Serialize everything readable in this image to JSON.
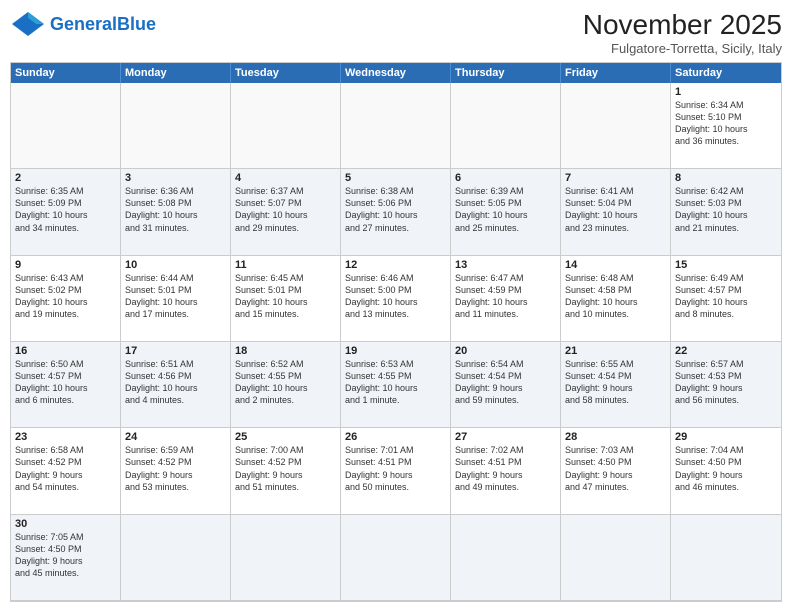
{
  "header": {
    "logo_general": "General",
    "logo_blue": "Blue",
    "month_title": "November 2025",
    "location": "Fulgatore-Torretta, Sicily, Italy"
  },
  "day_headers": [
    "Sunday",
    "Monday",
    "Tuesday",
    "Wednesday",
    "Thursday",
    "Friday",
    "Saturday"
  ],
  "cells": [
    {
      "day": "",
      "info": "",
      "empty": true
    },
    {
      "day": "",
      "info": "",
      "empty": true
    },
    {
      "day": "",
      "info": "",
      "empty": true
    },
    {
      "day": "",
      "info": "",
      "empty": true
    },
    {
      "day": "",
      "info": "",
      "empty": true
    },
    {
      "day": "",
      "info": "",
      "empty": true
    },
    {
      "day": "1",
      "info": "Sunrise: 6:34 AM\nSunset: 5:10 PM\nDaylight: 10 hours\nand 36 minutes.",
      "empty": false
    },
    {
      "day": "2",
      "info": "Sunrise: 6:35 AM\nSunset: 5:09 PM\nDaylight: 10 hours\nand 34 minutes.",
      "empty": false
    },
    {
      "day": "3",
      "info": "Sunrise: 6:36 AM\nSunset: 5:08 PM\nDaylight: 10 hours\nand 31 minutes.",
      "empty": false
    },
    {
      "day": "4",
      "info": "Sunrise: 6:37 AM\nSunset: 5:07 PM\nDaylight: 10 hours\nand 29 minutes.",
      "empty": false
    },
    {
      "day": "5",
      "info": "Sunrise: 6:38 AM\nSunset: 5:06 PM\nDaylight: 10 hours\nand 27 minutes.",
      "empty": false
    },
    {
      "day": "6",
      "info": "Sunrise: 6:39 AM\nSunset: 5:05 PM\nDaylight: 10 hours\nand 25 minutes.",
      "empty": false
    },
    {
      "day": "7",
      "info": "Sunrise: 6:41 AM\nSunset: 5:04 PM\nDaylight: 10 hours\nand 23 minutes.",
      "empty": false
    },
    {
      "day": "8",
      "info": "Sunrise: 6:42 AM\nSunset: 5:03 PM\nDaylight: 10 hours\nand 21 minutes.",
      "empty": false
    },
    {
      "day": "9",
      "info": "Sunrise: 6:43 AM\nSunset: 5:02 PM\nDaylight: 10 hours\nand 19 minutes.",
      "empty": false
    },
    {
      "day": "10",
      "info": "Sunrise: 6:44 AM\nSunset: 5:01 PM\nDaylight: 10 hours\nand 17 minutes.",
      "empty": false
    },
    {
      "day": "11",
      "info": "Sunrise: 6:45 AM\nSunset: 5:01 PM\nDaylight: 10 hours\nand 15 minutes.",
      "empty": false
    },
    {
      "day": "12",
      "info": "Sunrise: 6:46 AM\nSunset: 5:00 PM\nDaylight: 10 hours\nand 13 minutes.",
      "empty": false
    },
    {
      "day": "13",
      "info": "Sunrise: 6:47 AM\nSunset: 4:59 PM\nDaylight: 10 hours\nand 11 minutes.",
      "empty": false
    },
    {
      "day": "14",
      "info": "Sunrise: 6:48 AM\nSunset: 4:58 PM\nDaylight: 10 hours\nand 10 minutes.",
      "empty": false
    },
    {
      "day": "15",
      "info": "Sunrise: 6:49 AM\nSunset: 4:57 PM\nDaylight: 10 hours\nand 8 minutes.",
      "empty": false
    },
    {
      "day": "16",
      "info": "Sunrise: 6:50 AM\nSunset: 4:57 PM\nDaylight: 10 hours\nand 6 minutes.",
      "empty": false
    },
    {
      "day": "17",
      "info": "Sunrise: 6:51 AM\nSunset: 4:56 PM\nDaylight: 10 hours\nand 4 minutes.",
      "empty": false
    },
    {
      "day": "18",
      "info": "Sunrise: 6:52 AM\nSunset: 4:55 PM\nDaylight: 10 hours\nand 2 minutes.",
      "empty": false
    },
    {
      "day": "19",
      "info": "Sunrise: 6:53 AM\nSunset: 4:55 PM\nDaylight: 10 hours\nand 1 minute.",
      "empty": false
    },
    {
      "day": "20",
      "info": "Sunrise: 6:54 AM\nSunset: 4:54 PM\nDaylight: 9 hours\nand 59 minutes.",
      "empty": false
    },
    {
      "day": "21",
      "info": "Sunrise: 6:55 AM\nSunset: 4:54 PM\nDaylight: 9 hours\nand 58 minutes.",
      "empty": false
    },
    {
      "day": "22",
      "info": "Sunrise: 6:57 AM\nSunset: 4:53 PM\nDaylight: 9 hours\nand 56 minutes.",
      "empty": false
    },
    {
      "day": "23",
      "info": "Sunrise: 6:58 AM\nSunset: 4:52 PM\nDaylight: 9 hours\nand 54 minutes.",
      "empty": false
    },
    {
      "day": "24",
      "info": "Sunrise: 6:59 AM\nSunset: 4:52 PM\nDaylight: 9 hours\nand 53 minutes.",
      "empty": false
    },
    {
      "day": "25",
      "info": "Sunrise: 7:00 AM\nSunset: 4:52 PM\nDaylight: 9 hours\nand 51 minutes.",
      "empty": false
    },
    {
      "day": "26",
      "info": "Sunrise: 7:01 AM\nSunset: 4:51 PM\nDaylight: 9 hours\nand 50 minutes.",
      "empty": false
    },
    {
      "day": "27",
      "info": "Sunrise: 7:02 AM\nSunset: 4:51 PM\nDaylight: 9 hours\nand 49 minutes.",
      "empty": false
    },
    {
      "day": "28",
      "info": "Sunrise: 7:03 AM\nSunset: 4:50 PM\nDaylight: 9 hours\nand 47 minutes.",
      "empty": false
    },
    {
      "day": "29",
      "info": "Sunrise: 7:04 AM\nSunset: 4:50 PM\nDaylight: 9 hours\nand 46 minutes.",
      "empty": false
    },
    {
      "day": "30",
      "info": "Sunrise: 7:05 AM\nSunset: 4:50 PM\nDaylight: 9 hours\nand 45 minutes.",
      "empty": false
    },
    {
      "day": "",
      "info": "",
      "empty": true
    },
    {
      "day": "",
      "info": "",
      "empty": true
    },
    {
      "day": "",
      "info": "",
      "empty": true
    },
    {
      "day": "",
      "info": "",
      "empty": true
    },
    {
      "day": "",
      "info": "",
      "empty": true
    },
    {
      "day": "",
      "info": "",
      "empty": true
    }
  ]
}
